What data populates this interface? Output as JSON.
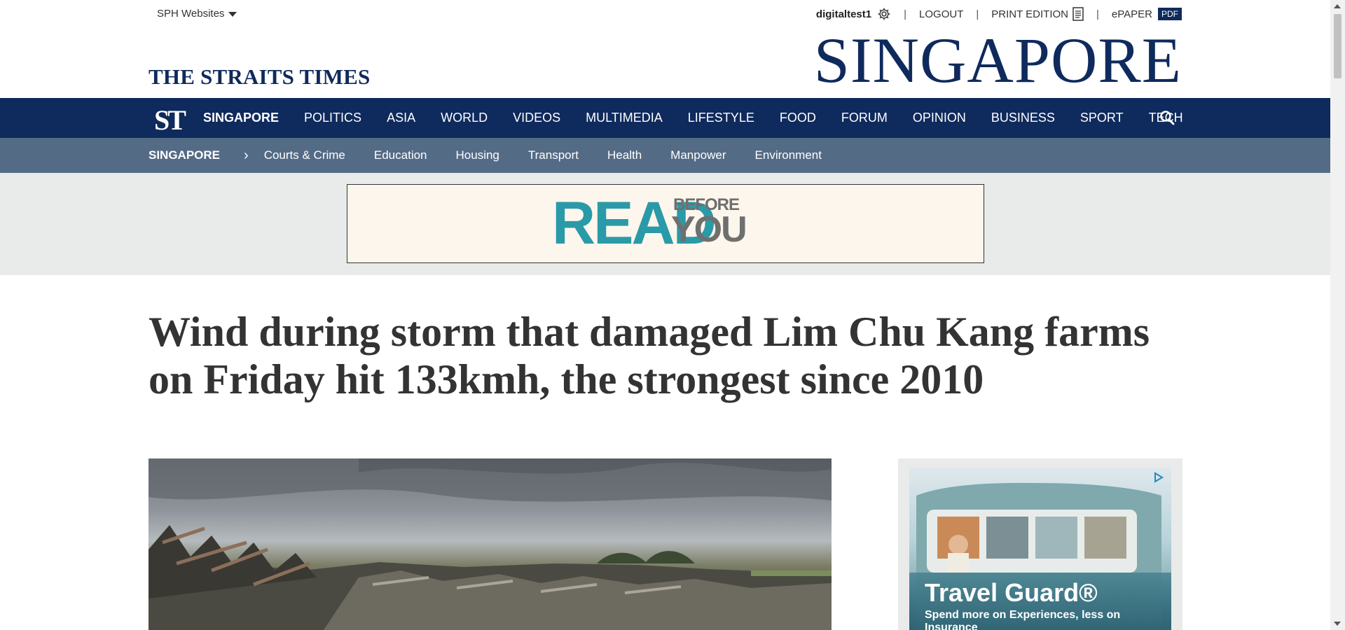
{
  "topbar": {
    "sph_label": "SPH Websites",
    "username": "digitaltest1",
    "logout": "LOGOUT",
    "print_edition": "PRINT EDITION",
    "epaper": "ePAPER",
    "pdf_badge": "PDF",
    "separator": "|"
  },
  "brand": {
    "logo": "THE STRAITS TIMES",
    "section_title": "SINGAPORE",
    "mark": "ST",
    "color": "#0f2a5c"
  },
  "nav": {
    "items": [
      "SINGAPORE",
      "POLITICS",
      "ASIA",
      "WORLD",
      "VIDEOS",
      "MULTIMEDIA",
      "LIFESTYLE",
      "FOOD",
      "FORUM",
      "OPINION",
      "BUSINESS",
      "SPORT",
      "TECH"
    ],
    "search_icon": "search-icon"
  },
  "subnav": {
    "root": "SINGAPORE",
    "chevron": "›",
    "items": [
      "Courts & Crime",
      "Education",
      "Housing",
      "Transport",
      "Health",
      "Manpower",
      "Environment"
    ],
    "color": "#546b86"
  },
  "ad_banner": {
    "read": "READ",
    "before": "BEFORE",
    "you": "YOU"
  },
  "article": {
    "headline": "Wind during storm that damaged Lim Chu Kang farms on Friday hit 133kmh, the strongest since 2010"
  },
  "side_ad": {
    "title": "Travel Guard®",
    "subtitle": "Spend more on Experiences, less on Insurance"
  }
}
